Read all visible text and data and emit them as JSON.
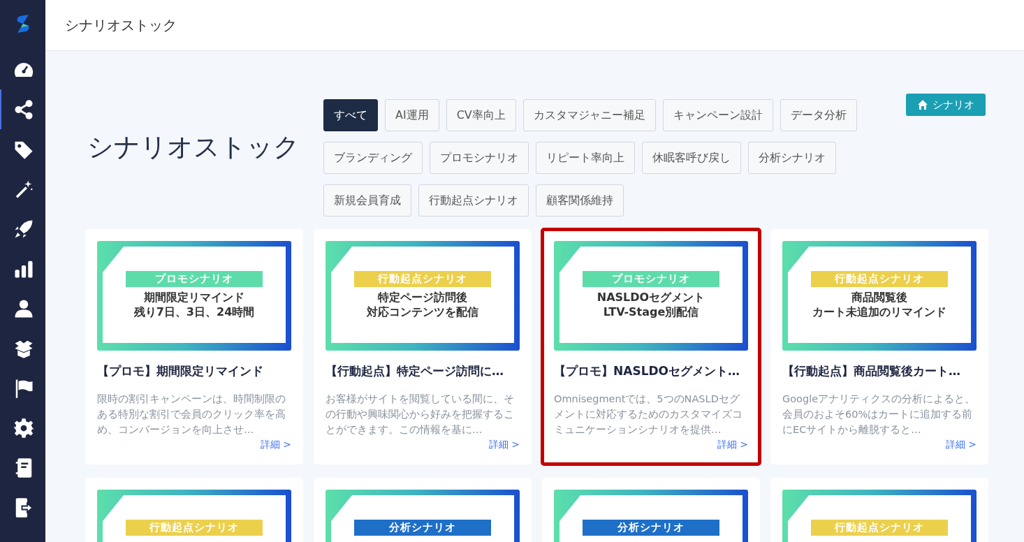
{
  "header": {
    "title": "シナリオストック"
  },
  "nav": [
    {
      "kind": "dashboard",
      "selected": false
    },
    {
      "kind": "share",
      "selected": true
    },
    {
      "kind": "tag",
      "selected": false
    },
    {
      "kind": "wand",
      "selected": false
    },
    {
      "kind": "rocket",
      "selected": false
    },
    {
      "kind": "chart",
      "selected": false
    },
    {
      "kind": "user",
      "selected": false
    },
    {
      "kind": "box",
      "selected": false
    },
    {
      "kind": "flag",
      "selected": false
    },
    {
      "kind": "gear",
      "selected": false
    },
    {
      "kind": "notebook",
      "selected": false
    },
    {
      "kind": "logout",
      "selected": false
    }
  ],
  "page_title": "シナリオストック",
  "home_button": {
    "label": "シナリオ"
  },
  "filters": [
    {
      "label": "すべて",
      "selected": true
    },
    {
      "label": "AI運用",
      "selected": false
    },
    {
      "label": "CV率向上",
      "selected": false
    },
    {
      "label": "カスタマジャニー補足",
      "selected": false
    },
    {
      "label": "キャンペーン設計",
      "selected": false
    },
    {
      "label": "データ分析",
      "selected": false
    },
    {
      "label": "ブランディング",
      "selected": false
    },
    {
      "label": "プロモシナリオ",
      "selected": false
    },
    {
      "label": "リピート率向上",
      "selected": false
    },
    {
      "label": "休眠客呼び戻し",
      "selected": false
    },
    {
      "label": "分析シナリオ",
      "selected": false
    },
    {
      "label": "新規会員育成",
      "selected": false
    },
    {
      "label": "行動起点シナリオ",
      "selected": false
    },
    {
      "label": "顧客関係維持",
      "selected": false
    }
  ],
  "cards": [
    {
      "highlighted": false,
      "tag": {
        "kind": "promo",
        "label": "プロモシナリオ"
      },
      "banner_lines": [
        "期間限定リマインド",
        "残り7日、3日、24時間"
      ],
      "title": "【プロモ】期間限定リマインド",
      "description": "限時の割引キャンペーンは、時間制限のある特別な割引で会員のクリック率を高め、コンバージョンを向上させ…",
      "link": "詳細 >"
    },
    {
      "highlighted": false,
      "tag": {
        "kind": "action",
        "label": "行動起点シナリオ"
      },
      "banner_lines": [
        "特定ページ訪問後",
        "対応コンテンツを配信"
      ],
      "title": "【行動起点】特定ページ訪問に…",
      "description": "お客様がサイトを閲覧している間に、その行動や興味関心から好みを把握することができます。この情報を基に…",
      "link": "詳細 >"
    },
    {
      "highlighted": true,
      "tag": {
        "kind": "promo",
        "label": "プロモシナリオ"
      },
      "banner_lines": [
        "NASLDOセグメント",
        "LTV-Stage別配信"
      ],
      "title": "【プロモ】NASLDOセグメント…",
      "description": "Omnisegmentでは、5つのNASLDセグメントに対応するためのカスタマイズコミュニケーションシナリオを提供…",
      "link": "詳細 >"
    },
    {
      "highlighted": false,
      "tag": {
        "kind": "action",
        "label": "行動起点シナリオ"
      },
      "banner_lines": [
        "商品閲覧後",
        "カート未追加のリマインド"
      ],
      "title": "【行動起点】商品閲覧後カート…",
      "description": "Googleアナリティクスの分析によると、会員のおよそ60%はカートに追加する前にECサイトから離脱すると…",
      "link": "詳細 >"
    },
    {
      "highlighted": false,
      "tag": {
        "kind": "action",
        "label": "行動起点シナリオ"
      }
    },
    {
      "highlighted": false,
      "tag": {
        "kind": "analysis",
        "label": "分析シナリオ"
      }
    },
    {
      "highlighted": false,
      "tag": {
        "kind": "analysis",
        "label": "分析シナリオ"
      }
    },
    {
      "highlighted": false,
      "tag": {
        "kind": "action",
        "label": "行動起点シナリオ"
      }
    }
  ]
}
